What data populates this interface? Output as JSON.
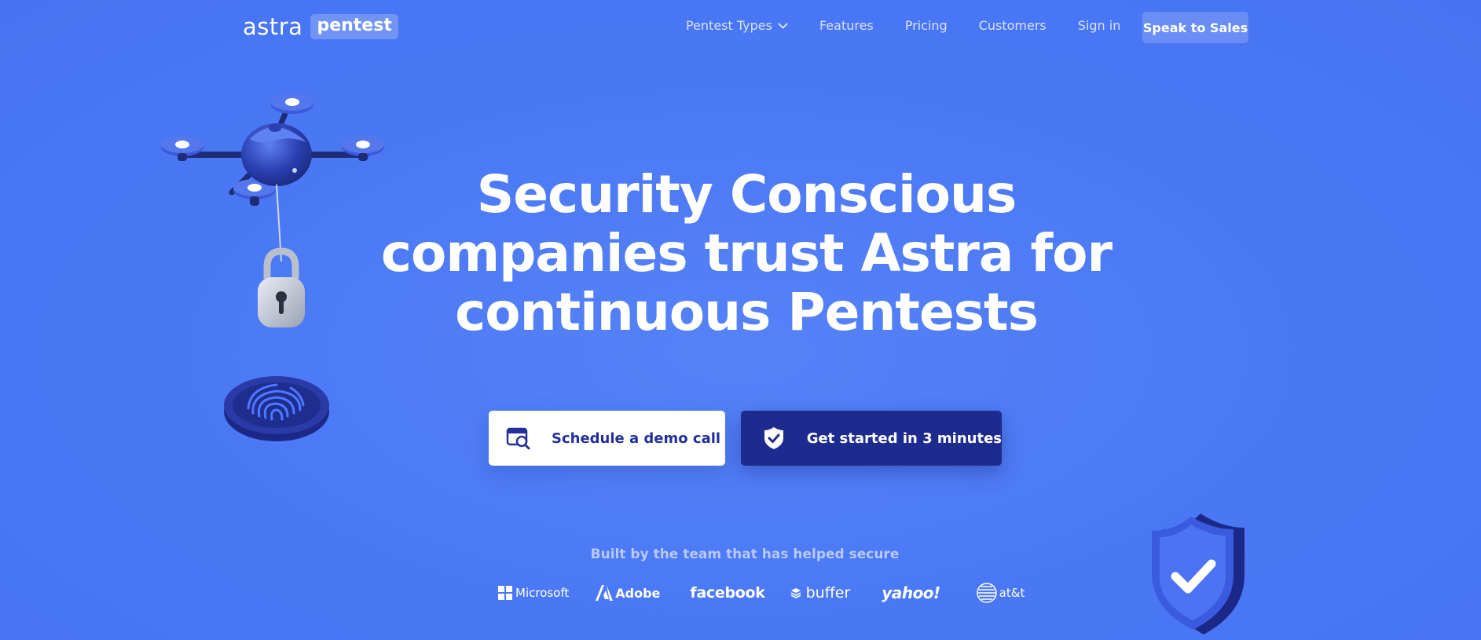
{
  "brand": {
    "name": "astra",
    "product": "pentest"
  },
  "nav": {
    "items": [
      {
        "label": "Pentest Types",
        "has_dropdown": true
      },
      {
        "label": "Features"
      },
      {
        "label": "Pricing"
      },
      {
        "label": "Customers"
      },
      {
        "label": "Sign in"
      }
    ],
    "cta_label": "Speak to Sales"
  },
  "hero": {
    "headline_lines": [
      "Security Conscious",
      "companies trust Astra for",
      "continuous Pentests"
    ],
    "buttons": {
      "demo_label": "Schedule a demo call",
      "start_label": "Get started in 3 minutes"
    }
  },
  "trust": {
    "caption": "Built by the team that has helped secure",
    "logos": [
      {
        "name": "Microsoft",
        "icon": "microsoft-logo"
      },
      {
        "name": "Adobe",
        "icon": "adobe-logo"
      },
      {
        "name": "facebook",
        "icon": "facebook-logo"
      },
      {
        "name": "buffer",
        "icon": "buffer-logo"
      },
      {
        "name": "yahoo!",
        "icon": "yahoo-logo"
      },
      {
        "name": "at&t",
        "icon": "att-logo"
      }
    ]
  },
  "illustrations": [
    {
      "name": "drone-with-padlock",
      "icon": "drone-icon"
    },
    {
      "name": "fingerprint-pad",
      "icon": "fingerprint-icon"
    },
    {
      "name": "shield-check",
      "icon": "shield-check-icon"
    }
  ],
  "colors": {
    "background": "#4a78f5",
    "primary_dark": "#1d2b8f",
    "white": "#ffffff",
    "caption": "#b8c9fb",
    "nav_text": "#d7e1ff"
  }
}
